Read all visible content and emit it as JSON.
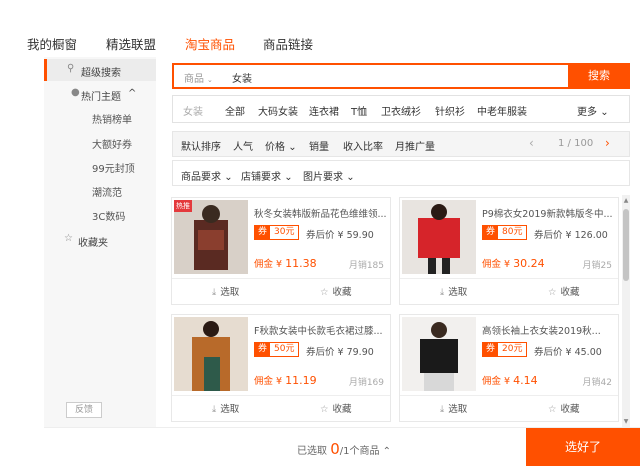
{
  "tabs": [
    "我的橱窗",
    "精选联盟",
    "淘宝商品",
    "商品链接"
  ],
  "sidebar": {
    "super_search": "超级搜索",
    "hot_topics": "热门主题",
    "hot_arrow": "^",
    "sub_items": [
      "热销榜单",
      "大额好券",
      "99元封顶",
      "潮流范",
      "3C数码"
    ],
    "favorites": "收藏夹",
    "feedback": "反馈"
  },
  "search": {
    "scope": "商品",
    "value": "女装",
    "button": "搜索"
  },
  "categories": {
    "label": "女装",
    "items": [
      "全部",
      "大码女装",
      "连衣裙",
      "T恤",
      "卫衣绒衫",
      "针织衫",
      "中老年服装"
    ],
    "more": "更多"
  },
  "sort": {
    "items": [
      "默认排序",
      "人气",
      "价格",
      "销量",
      "收入比率",
      "月推广量"
    ],
    "page": "1 / 100"
  },
  "filters": [
    "商品要求",
    "店铺要求",
    "图片要求"
  ],
  "products": [
    {
      "badge": "热推",
      "title": "秋冬女装韩版新品花色维维领...",
      "coupon_label": "券",
      "coupon_value": "30元",
      "after_price": "券后价 ¥ 59.90",
      "commission_label": "佣金 ¥",
      "commission_value": "11.38",
      "sales": "月销185",
      "select": "选取",
      "collect": "收藏"
    },
    {
      "badge": "",
      "title": "P9棉衣女2019新款韩版冬中...",
      "coupon_label": "券",
      "coupon_value": "80元",
      "after_price": "券后价 ¥ 126.00",
      "commission_label": "佣金 ¥",
      "commission_value": "30.24",
      "sales": "月销25",
      "select": "选取",
      "collect": "收藏"
    },
    {
      "badge": "",
      "title": "F秋款女装中长款毛衣裙过膝...",
      "coupon_label": "券",
      "coupon_value": "50元",
      "after_price": "券后价 ¥ 79.90",
      "commission_label": "佣金 ¥",
      "commission_value": "11.19",
      "sales": "月销169",
      "select": "选取",
      "collect": "收藏"
    },
    {
      "badge": "",
      "title": "高领长袖上衣女装2019秋...",
      "coupon_label": "券",
      "coupon_value": "20元",
      "after_price": "券后价 ¥ 45.00",
      "commission_label": "佣金 ¥",
      "commission_value": "4.14",
      "sales": "月销42",
      "select": "选取",
      "collect": "收藏"
    }
  ],
  "footer": {
    "prefix": "已选取",
    "count": "0",
    "suffix": "/1个商品",
    "done": "选好了"
  },
  "colors": {
    "accent": "#ff5000"
  }
}
